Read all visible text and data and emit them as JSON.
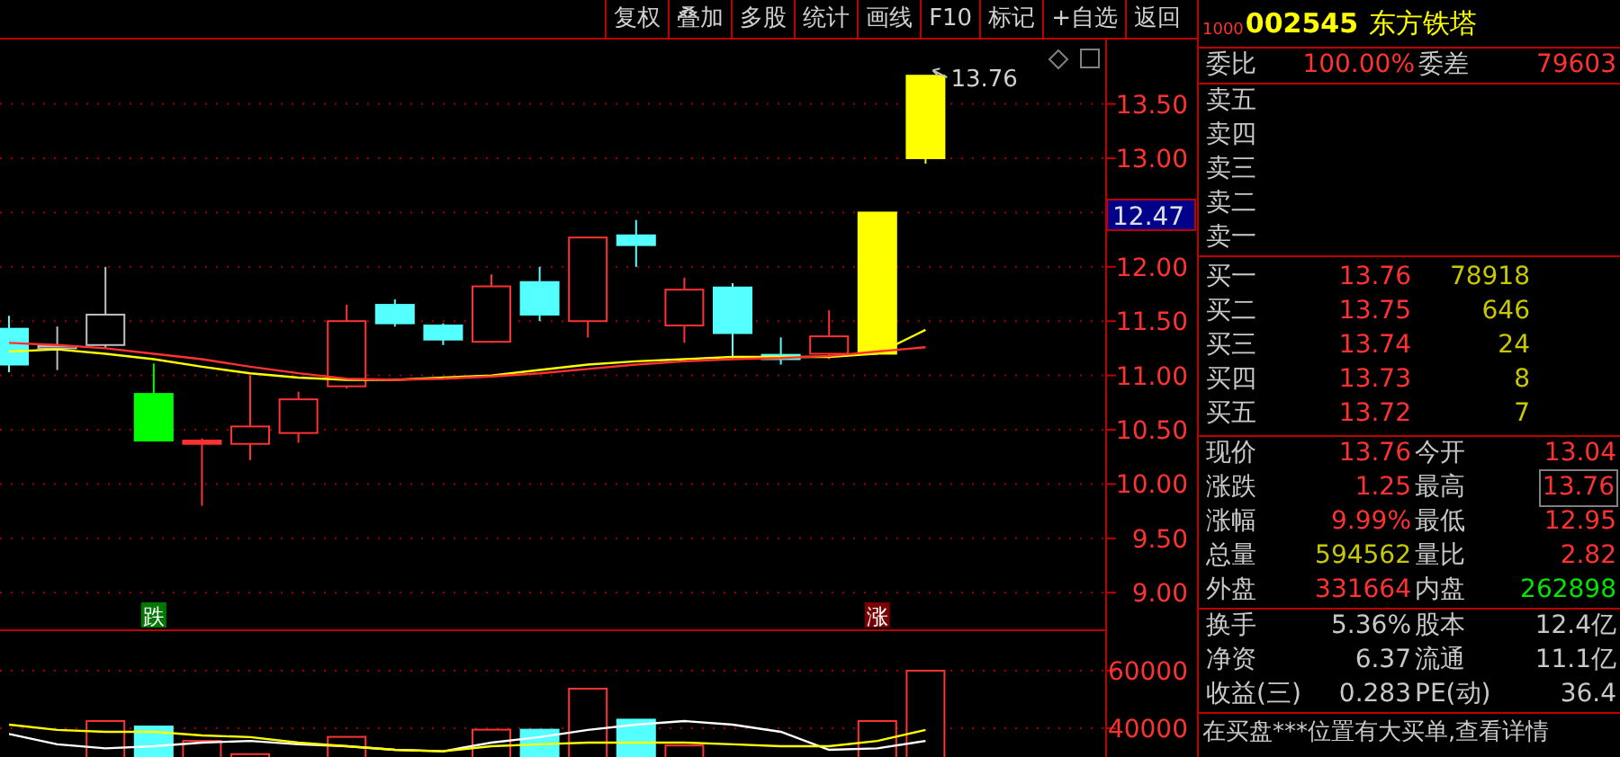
{
  "toolbar": [
    {
      "label": "复权"
    },
    {
      "label": "叠加"
    },
    {
      "label": "多股"
    },
    {
      "label": "统计"
    },
    {
      "label": "画线"
    },
    {
      "label": "F10"
    },
    {
      "label": "标记"
    },
    {
      "label": "+自选"
    },
    {
      "label": "返回"
    }
  ],
  "price_chart": {
    "axis_labels": [
      "13.50",
      "13.00",
      "12.00",
      "11.50",
      "11.00",
      "10.50",
      "10.00",
      "9.50",
      "9.00"
    ],
    "current_price_tag": "12.47",
    "high_label": "13.76",
    "markers": [
      {
        "text": "跌",
        "kind": "down"
      },
      {
        "text": "涨",
        "kind": "up"
      }
    ]
  },
  "volume_chart": {
    "axis_labels": [
      "60000",
      "40000"
    ]
  },
  "quote_panel": {
    "header": {
      "prefix": "1000",
      "code": "002545",
      "name": "东方铁塔"
    },
    "ratio": [
      {
        "label": "委比",
        "value": "100.00%"
      },
      {
        "label": "委差",
        "value": "79603"
      }
    ],
    "sell": [
      {
        "label": "卖五"
      },
      {
        "label": "卖四"
      },
      {
        "label": "卖三"
      },
      {
        "label": "卖二"
      },
      {
        "label": "卖一"
      }
    ],
    "buy": [
      {
        "label": "买一",
        "price": "13.76",
        "volume": "78918"
      },
      {
        "label": "买二",
        "price": "13.75",
        "volume": "646"
      },
      {
        "label": "买三",
        "price": "13.74",
        "volume": "24"
      },
      {
        "label": "买四",
        "price": "13.73",
        "volume": "8"
      },
      {
        "label": "买五",
        "price": "13.72",
        "volume": "7"
      }
    ],
    "quotes": [
      [
        {
          "label": "现价",
          "value": "13.76",
          "color": "#ff3232",
          "boxed": false
        },
        {
          "label": "今开",
          "value": "13.04",
          "color": "#ff3232",
          "boxed": false
        }
      ],
      [
        {
          "label": "涨跌",
          "value": "1.25",
          "color": "#ff3232",
          "boxed": false
        },
        {
          "label": "最高",
          "value": "13.76",
          "color": "#ff3232",
          "boxed": true
        }
      ],
      [
        {
          "label": "涨幅",
          "value": "9.99%",
          "color": "#ff3232",
          "boxed": false
        },
        {
          "label": "最低",
          "value": "12.95",
          "color": "#ff3232",
          "boxed": false
        }
      ],
      [
        {
          "label": "总量",
          "value": "594562",
          "color": "#c8c800",
          "boxed": false
        },
        {
          "label": "量比",
          "value": "2.82",
          "color": "#ff3232",
          "boxed": false
        }
      ],
      [
        {
          "label": "外盘",
          "value": "331664",
          "color": "#ff3232",
          "boxed": false
        },
        {
          "label": "内盘",
          "value": "262898",
          "color": "#00e600",
          "boxed": false
        }
      ]
    ],
    "fundamentals": [
      [
        {
          "label": "换手",
          "value": "5.36%"
        },
        {
          "label": "股本",
          "value": "12.4亿"
        }
      ],
      [
        {
          "label": "净资",
          "value": "6.37"
        },
        {
          "label": "流通",
          "value": "11.1亿"
        }
      ],
      [
        {
          "label": "收益(三)",
          "value": "0.283"
        },
        {
          "label": "PE(动)",
          "value": "36.4"
        }
      ]
    ],
    "footer": "在买盘***位置有大买单,查看详情"
  }
}
